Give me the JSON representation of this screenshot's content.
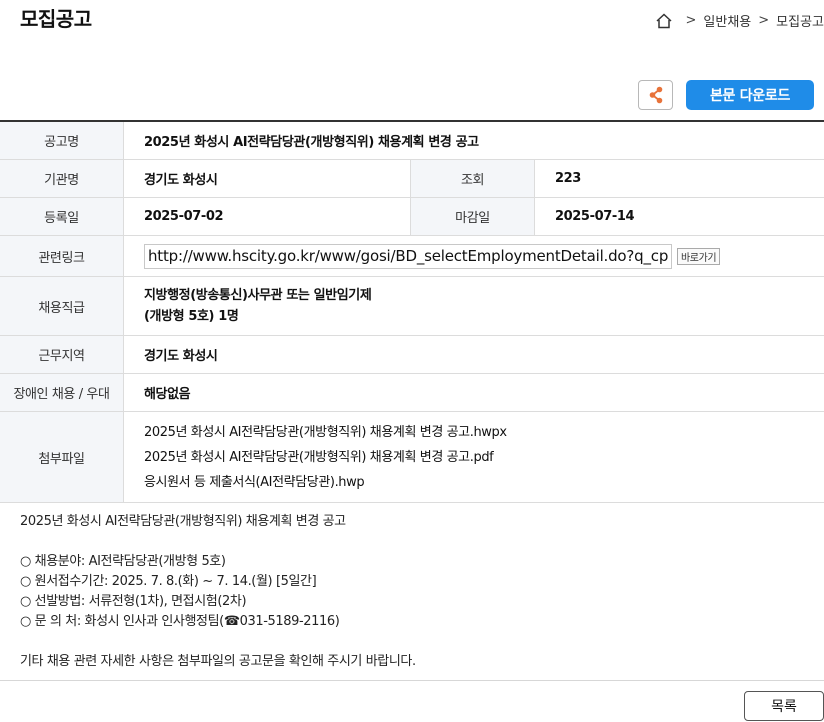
{
  "page_title": "모집공고",
  "breadcrumb": {
    "items": [
      "일반채용",
      "모집공고"
    ]
  },
  "actions": {
    "download_label": "본문 다운로드",
    "list_label": "목록"
  },
  "details": {
    "title_label": "공고명",
    "title_value": "2025년 화성시 AI전략담당관(개방형직위) 채용계획 변경 공고",
    "org_label": "기관명",
    "org_value": "경기도 화성시",
    "views_label": "조회",
    "views_value": "223",
    "reg_label": "등록일",
    "reg_value": "2025-07-02",
    "deadline_label": "마감일",
    "deadline_value": "2025-07-14",
    "link_label": "관련링크",
    "link_value": "http://www.hscity.go.kr/www/gosi/BD_selectEmploymentDetail.do?q_cp",
    "link_button": "바로가기",
    "grade_label": "채용직급",
    "grade_line1": "지방행정(방송통신)사무관 또는 일반임기제",
    "grade_line2": "(개방형 5호) 1명",
    "location_label": "근무지역",
    "location_value": "경기도 화성시",
    "disabled_label": "장애인 채용 / 우대",
    "disabled_value": "해당없음",
    "files_label": "첨부파일",
    "files": [
      "2025년 화성시 AI전략담당관(개방형직위) 채용계획 변경 공고.hwpx",
      "2025년 화성시 AI전략담당관(개방형직위) 채용계획 변경 공고.pdf",
      "응시원서 등 제출서식(AI전략담당관).hwp"
    ]
  },
  "body": {
    "heading": "2025년 화성시 AI전략담당관(개방형직위) 채용계획 변경 공고",
    "bullets": [
      "○ 채용분야: AI전략담당관(개방형 5호)",
      "○ 원서접수기간: 2025. 7. 8.(화) ~ 7. 14.(월) [5일간]",
      "○ 선발방법: 서류전형(1차), 면접시험(2차)",
      "○ 문 의 처: 화성시 인사과 인사행정팀(☎031-5189-2116)"
    ],
    "footer": "기타 채용 관련 자세한 사항은 첨부파일의 공고문을 확인해 주시기 바랍니다."
  },
  "colors": {
    "accent": "#1f8ce8",
    "share_icon": "#e8733a",
    "header_bg": "#f4f6f9"
  },
  "icons": {
    "home": "home-icon",
    "share": "share-icon"
  }
}
